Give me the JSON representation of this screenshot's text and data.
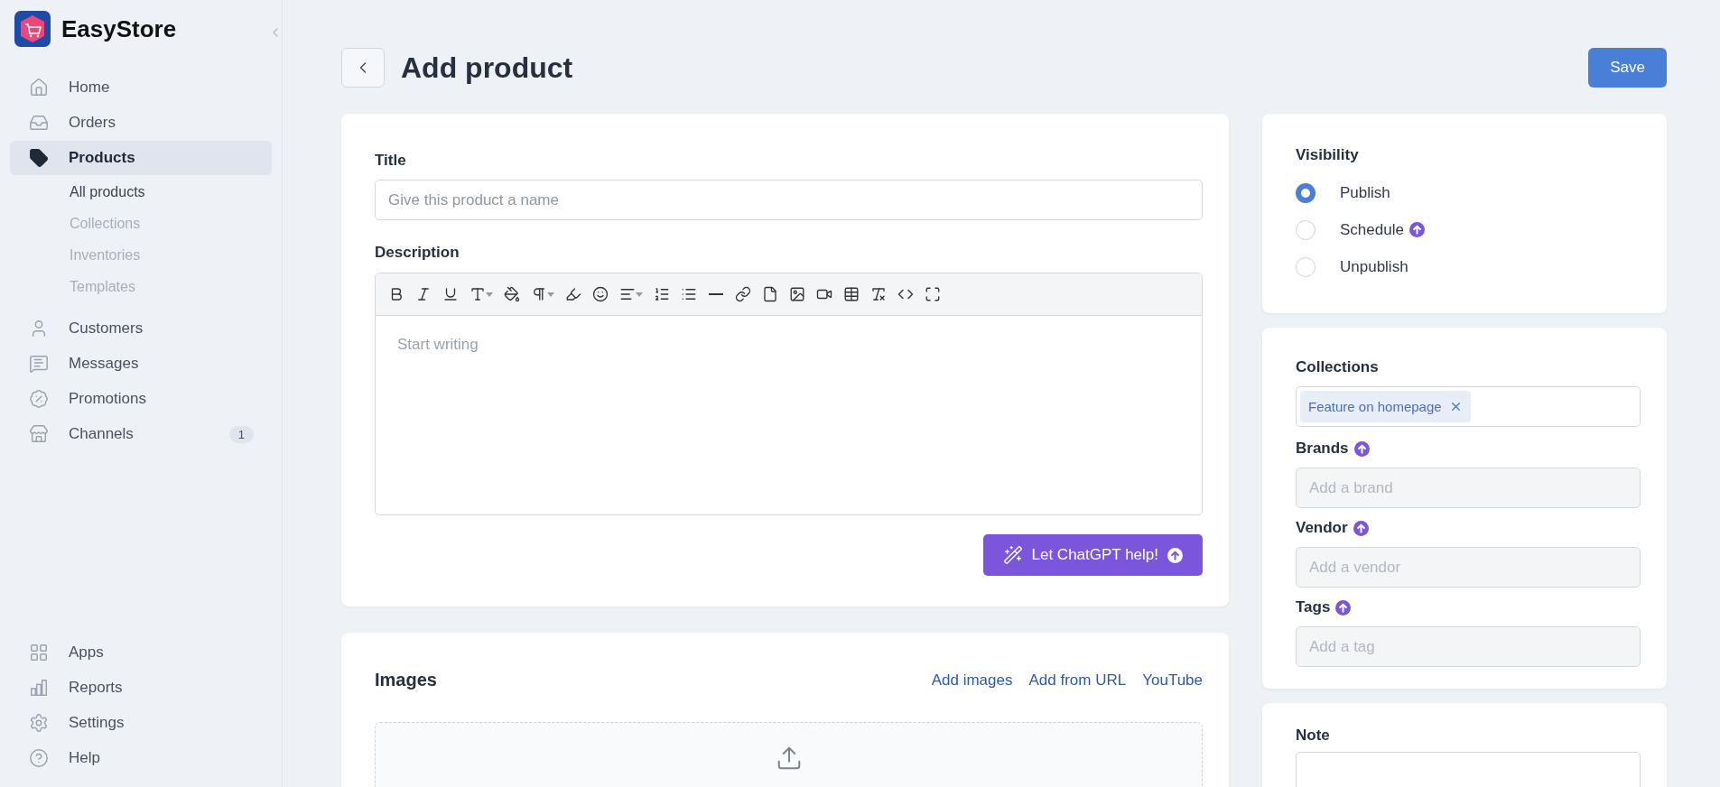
{
  "brand": {
    "name": "EasyStore"
  },
  "sidebar": {
    "items": [
      {
        "label": "Home",
        "selected": false
      },
      {
        "label": "Orders",
        "selected": false
      },
      {
        "label": "Products",
        "selected": true,
        "children": [
          {
            "label": "All products",
            "selected": true
          },
          {
            "label": "Collections",
            "selected": false
          },
          {
            "label": "Inventories",
            "selected": false
          },
          {
            "label": "Templates",
            "selected": false
          }
        ]
      },
      {
        "label": "Customers",
        "selected": false
      },
      {
        "label": "Messages",
        "selected": false
      },
      {
        "label": "Promotions",
        "selected": false
      },
      {
        "label": "Channels",
        "selected": false,
        "badge": "1"
      }
    ],
    "bottom_items": [
      {
        "label": "Apps",
        "selected": false
      },
      {
        "label": "Reports",
        "selected": false
      },
      {
        "label": "Settings",
        "selected": false
      },
      {
        "label": "Help",
        "selected": false
      }
    ]
  },
  "page": {
    "title": "Add product",
    "save_button": "Save"
  },
  "product_card": {
    "title_label": "Title",
    "title_placeholder": "Give this product a name",
    "description_label": "Description",
    "description_placeholder": "Start writing",
    "ai_button": "Let ChatGPT help!"
  },
  "images": {
    "title": "Images",
    "links": [
      "Add images",
      "Add from URL",
      "YouTube"
    ]
  },
  "visibility": {
    "title": "Visibility",
    "options": [
      {
        "label": "Publish",
        "selected": true,
        "upgrade": false
      },
      {
        "label": "Schedule",
        "selected": false,
        "upgrade": true
      },
      {
        "label": "Unpublish",
        "selected": false,
        "upgrade": false
      }
    ]
  },
  "organization": {
    "collections_label": "Collections",
    "collections": [
      {
        "label": "Feature on homepage"
      }
    ],
    "fields": [
      {
        "label": "Brands",
        "placeholder": "Add a brand",
        "upgrade": true,
        "disabled": true
      },
      {
        "label": "Vendor",
        "placeholder": "Add a vendor",
        "upgrade": true,
        "disabled": true
      },
      {
        "label": "Tags",
        "placeholder": "Add a tag",
        "upgrade": true,
        "disabled": true
      }
    ]
  },
  "note": {
    "title": "Note"
  }
}
